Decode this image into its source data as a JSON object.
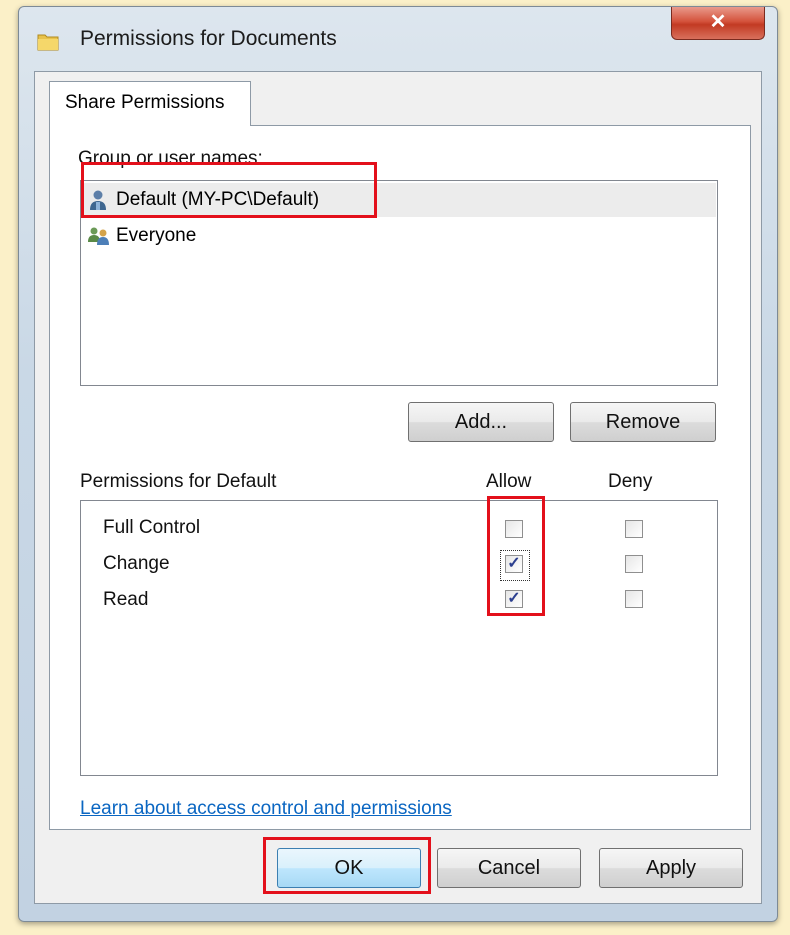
{
  "window": {
    "title": "Permissions for Documents",
    "close_label": "✕"
  },
  "tabs": [
    {
      "label": "Share Permissions"
    }
  ],
  "group_section": {
    "label": "Group or user names:",
    "items": [
      {
        "label": "Default (MY-PC\\Default)",
        "icon": "user-icon",
        "selected": true
      },
      {
        "label": "Everyone",
        "icon": "users-group-icon",
        "selected": false
      }
    ],
    "add_label": "Add...",
    "remove_label": "Remove"
  },
  "permissions": {
    "label": "Permissions for Default",
    "allow_header": "Allow",
    "deny_header": "Deny",
    "rows": [
      {
        "name": "Full Control",
        "allow": false,
        "deny": false
      },
      {
        "name": "Change",
        "allow": true,
        "deny": false
      },
      {
        "name": "Read",
        "allow": true,
        "deny": false
      }
    ]
  },
  "help_link": "Learn about access control and permissions",
  "footer": {
    "ok_label": "OK",
    "cancel_label": "Cancel",
    "apply_label": "Apply"
  },
  "colors": {
    "highlight_box": "#e3101b",
    "link": "#0a66c2",
    "check": "#2c3f8f"
  }
}
